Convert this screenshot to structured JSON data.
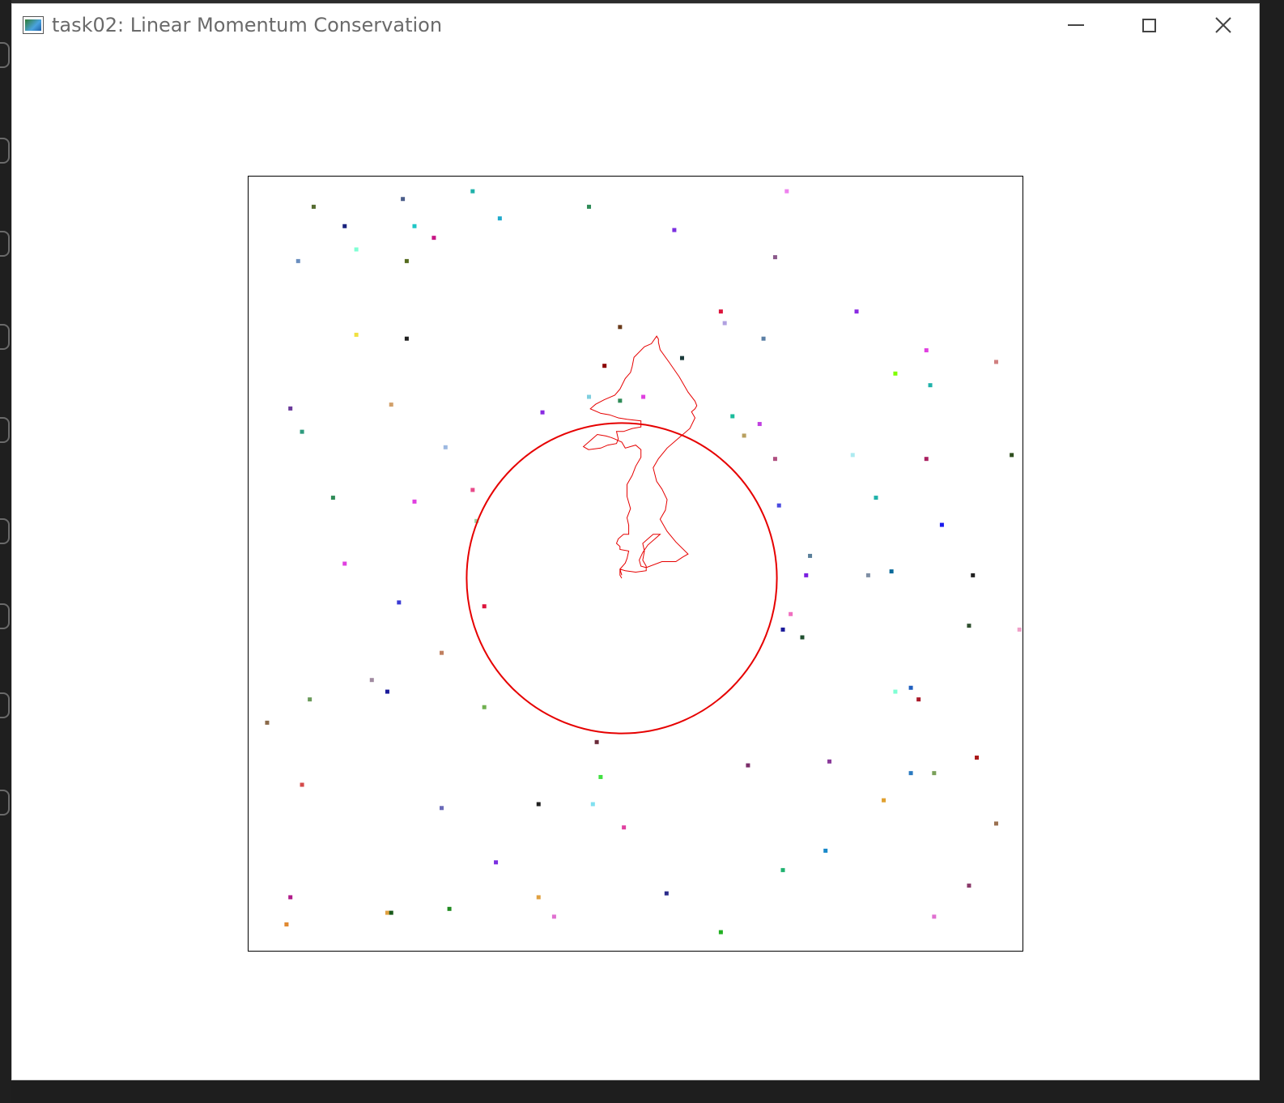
{
  "window": {
    "title": "task02: Linear Momentum Conservation",
    "controls": {
      "minimize": "minimize-icon",
      "maximize": "maximize-icon",
      "close": "close-icon"
    }
  },
  "scene": {
    "frame_color": "#000000",
    "big_particle": {
      "color": "#e60000",
      "radius_units": 0.4,
      "center": [
        0.0,
        0.0
      ]
    },
    "trajectory": {
      "color": "#e60000",
      "points": [
        [
          0.0,
          0.0
        ],
        [
          -0.01,
          0.02
        ],
        [
          -0.01,
          0.06
        ],
        [
          0.02,
          0.05
        ],
        [
          0.08,
          0.04
        ],
        [
          0.14,
          0.05
        ],
        [
          0.14,
          0.08
        ],
        [
          0.12,
          0.12
        ],
        [
          0.13,
          0.18
        ],
        [
          0.12,
          0.23
        ],
        [
          0.15,
          0.26
        ],
        [
          0.18,
          0.29
        ],
        [
          0.22,
          0.29
        ],
        [
          0.19,
          0.26
        ],
        [
          0.15,
          0.22
        ],
        [
          0.12,
          0.17
        ],
        [
          0.1,
          0.12
        ],
        [
          0.11,
          0.08
        ],
        [
          0.14,
          0.07
        ],
        [
          0.23,
          0.11
        ],
        [
          0.31,
          0.11
        ],
        [
          0.35,
          0.14
        ],
        [
          0.38,
          0.16
        ],
        [
          0.38,
          0.16
        ],
        [
          0.31,
          0.24
        ],
        [
          0.26,
          0.31
        ],
        [
          0.22,
          0.39
        ],
        [
          0.25,
          0.45
        ],
        [
          0.26,
          0.52
        ],
        [
          0.23,
          0.59
        ],
        [
          0.2,
          0.64
        ],
        [
          0.18,
          0.73
        ],
        [
          0.21,
          0.79
        ],
        [
          0.26,
          0.86
        ],
        [
          0.33,
          0.93
        ],
        [
          0.39,
          0.99
        ],
        [
          0.42,
          1.06
        ],
        [
          0.4,
          1.1
        ],
        [
          0.42,
          1.12
        ],
        [
          0.43,
          1.14
        ],
        [
          0.42,
          1.17
        ],
        [
          0.38,
          1.23
        ],
        [
          0.33,
          1.33
        ],
        [
          0.27,
          1.43
        ],
        [
          0.22,
          1.51
        ],
        [
          0.21,
          1.56
        ],
        [
          0.21,
          1.58
        ],
        [
          0.2,
          1.6
        ],
        [
          0.17,
          1.55
        ],
        [
          0.13,
          1.53
        ],
        [
          0.07,
          1.46
        ],
        [
          0.06,
          1.4
        ],
        [
          0.05,
          1.36
        ],
        [
          0.02,
          1.32
        ],
        [
          -0.01,
          1.25
        ],
        [
          -0.04,
          1.21
        ],
        [
          -0.1,
          1.18
        ],
        [
          -0.15,
          1.15
        ],
        [
          -0.18,
          1.12
        ],
        [
          -0.12,
          1.09
        ],
        [
          -0.07,
          1.08
        ],
        [
          -0.02,
          1.06
        ],
        [
          0.03,
          1.05
        ],
        [
          0.11,
          1.04
        ],
        [
          0.11,
          1.0
        ],
        [
          0.06,
          0.99
        ],
        [
          0.01,
          0.97
        ],
        [
          -0.03,
          0.97
        ],
        [
          -0.02,
          0.92
        ],
        [
          -0.03,
          0.89
        ],
        [
          -0.08,
          0.88
        ],
        [
          -0.12,
          0.86
        ],
        [
          -0.19,
          0.85
        ],
        [
          -0.22,
          0.87
        ],
        [
          -0.17,
          0.92
        ],
        [
          -0.14,
          0.95
        ],
        [
          -0.09,
          0.94
        ],
        [
          -0.06,
          0.93
        ],
        [
          -0.04,
          0.92
        ],
        [
          0.0,
          0.9
        ],
        [
          0.02,
          0.86
        ],
        [
          0.08,
          0.88
        ],
        [
          0.11,
          0.85
        ],
        [
          0.11,
          0.8
        ],
        [
          0.08,
          0.74
        ],
        [
          0.06,
          0.68
        ],
        [
          0.03,
          0.62
        ],
        [
          0.03,
          0.54
        ],
        [
          0.05,
          0.46
        ],
        [
          0.03,
          0.4
        ],
        [
          0.04,
          0.35
        ],
        [
          0.04,
          0.29
        ],
        [
          0.01,
          0.29
        ],
        [
          -0.02,
          0.26
        ],
        [
          -0.03,
          0.23
        ],
        [
          -0.01,
          0.21
        ],
        [
          -0.01,
          0.19
        ],
        [
          0.04,
          0.18
        ],
        [
          0.03,
          0.13
        ],
        [
          0.02,
          0.1
        ],
        [
          -0.01,
          0.06
        ],
        [
          0.0,
          0.02
        ]
      ]
    },
    "particles": [
      [
        "#556b2f",
        -0.83,
        0.92
      ],
      [
        "#4b5d8a",
        -0.6,
        0.94
      ],
      [
        "#20b2aa",
        -0.42,
        0.96
      ],
      [
        "#2e8b57",
        -0.12,
        0.92
      ],
      [
        "#d4aa00",
        0.27,
        1.02
      ],
      [
        "#ee82ee",
        0.39,
        0.96
      ],
      [
        "#1a237e",
        -0.75,
        0.87
      ],
      [
        "#20c7c7",
        -0.57,
        0.87
      ],
      [
        "#20aacc",
        -0.35,
        0.89
      ],
      [
        "#c71585",
        -0.52,
        0.84
      ],
      [
        "#7b2fe0",
        0.1,
        0.86
      ],
      [
        "#7fffd4",
        -0.72,
        0.81
      ],
      [
        "#6a8ebf",
        -0.87,
        0.78
      ],
      [
        "#556b1f",
        -0.59,
        0.78
      ],
      [
        "#8b5a8b",
        0.36,
        0.79
      ],
      [
        "#8a2be2",
        0.57,
        0.65
      ],
      [
        "#6a3a1a",
        -0.04,
        0.61
      ],
      [
        "#dc143c",
        0.22,
        0.65
      ],
      [
        "#b0a0e0",
        0.23,
        0.62
      ],
      [
        "#5a7fa5",
        0.33,
        0.58
      ],
      [
        "#f0e040",
        -0.72,
        0.59
      ],
      [
        "#202020",
        -0.59,
        0.58
      ],
      [
        "#8b0000",
        -0.08,
        0.51
      ],
      [
        "#1a3a3a",
        0.12,
        0.53
      ],
      [
        "#d08080",
        0.93,
        0.52
      ],
      [
        "#e040e0",
        0.75,
        0.55
      ],
      [
        "#7fff00",
        0.67,
        0.49
      ],
      [
        "#20b2aa",
        0.76,
        0.46
      ],
      [
        "#7fcfdf",
        -0.12,
        0.43
      ],
      [
        "#2e8b57",
        -0.04,
        0.42
      ],
      [
        "#e040e0",
        0.02,
        0.43
      ],
      [
        "#d2a06a",
        -0.63,
        0.41
      ],
      [
        "#6a3a9a",
        -0.89,
        0.4
      ],
      [
        "#8a2be2",
        -0.24,
        0.39
      ],
      [
        "#1abc9c",
        0.25,
        0.38
      ],
      [
        "#c040e0",
        0.32,
        0.36
      ],
      [
        "#b8a060",
        0.28,
        0.33
      ],
      [
        "#2e9b7e",
        -0.86,
        0.34
      ],
      [
        "#9cb8e0",
        -0.49,
        0.3
      ],
      [
        "#adeaf0",
        0.56,
        0.28
      ],
      [
        "#aa2060",
        0.75,
        0.27
      ],
      [
        "#2f4f1f",
        0.97,
        0.28
      ],
      [
        "#b05080",
        0.36,
        0.27
      ],
      [
        "#e84a8a",
        -0.42,
        0.19
      ],
      [
        "#2e8b57",
        -0.78,
        0.17
      ],
      [
        "#e040e0",
        -0.57,
        0.16
      ],
      [
        "#20b2aa",
        0.62,
        0.17
      ],
      [
        "#4a4ae0",
        0.37,
        0.15
      ],
      [
        "#9ad4a0",
        -0.41,
        0.11
      ],
      [
        "#1a1aee",
        0.79,
        0.1
      ],
      [
        "#5a7f9a",
        0.45,
        0.02
      ],
      [
        "#e040e0",
        -0.75,
        0.0
      ],
      [
        "#7b1fe0",
        0.44,
        -0.03
      ],
      [
        "#7f8fa5",
        0.6,
        -0.03
      ],
      [
        "#0a6a9a",
        0.66,
        -0.02
      ],
      [
        "#202020",
        0.87,
        -0.03
      ],
      [
        "#3a3ad4",
        -0.61,
        -0.1
      ],
      [
        "#dc143c",
        -0.39,
        -0.11
      ],
      [
        "#f070c0",
        0.4,
        -0.13
      ],
      [
        "#1a1a9a",
        0.38,
        -0.17
      ],
      [
        "#1f4f2f",
        0.43,
        -0.19
      ],
      [
        "#2f4f2f",
        0.86,
        -0.16
      ],
      [
        "#f0a0c8",
        0.99,
        -0.17
      ],
      [
        "#c08060",
        -0.5,
        -0.23
      ],
      [
        "#a08aa0",
        -0.68,
        -0.3
      ],
      [
        "#1a1a9a",
        -0.64,
        -0.33
      ],
      [
        "#7fffd4",
        0.67,
        -0.33
      ],
      [
        "#2060c0",
        0.71,
        -0.32
      ],
      [
        "#aa1a2a",
        0.73,
        -0.35
      ],
      [
        "#6a9a5a",
        -0.84,
        -0.35
      ],
      [
        "#70b050",
        -0.39,
        -0.37
      ],
      [
        "#8b6a4a",
        -0.95,
        -0.41
      ],
      [
        "#6a2a3a",
        -0.1,
        -0.46
      ],
      [
        "#7b2e6a",
        0.29,
        -0.52
      ],
      [
        "#8a3a9a",
        0.5,
        -0.51
      ],
      [
        "#aa1a1a",
        0.88,
        -0.5
      ],
      [
        "#2a7ac0",
        0.71,
        -0.54
      ],
      [
        "#7aa05a",
        0.77,
        -0.54
      ],
      [
        "#40e040",
        -0.09,
        -0.55
      ],
      [
        "#d44a4a",
        -0.86,
        -0.57
      ],
      [
        "#e0a030",
        0.64,
        -0.61
      ],
      [
        "#6a6ab8",
        -0.5,
        -0.63
      ],
      [
        "#202020",
        -0.25,
        -0.62
      ],
      [
        "#80e0f0",
        -0.11,
        -0.62
      ],
      [
        "#e040a0",
        -0.03,
        -0.68
      ],
      [
        "#9a7050",
        0.93,
        -0.67
      ],
      [
        "#1a8aca",
        0.49,
        -0.74
      ],
      [
        "#7b2fe0",
        -0.36,
        -0.77
      ],
      [
        "#20b270",
        0.38,
        -0.79
      ],
      [
        "#2a2a8a",
        0.08,
        -0.85
      ],
      [
        "#8a3a6a",
        0.86,
        -0.83
      ],
      [
        "#b01a8a",
        -0.89,
        -0.86
      ],
      [
        "#e0a040",
        -0.64,
        -0.9
      ],
      [
        "#e0a040",
        -0.25,
        -0.86
      ],
      [
        "#208a20",
        -0.48,
        -0.89
      ],
      [
        "#1a5a1a",
        -0.63,
        -0.9
      ],
      [
        "#e070d0",
        -0.21,
        -0.91
      ],
      [
        "#e070d0",
        0.77,
        -0.91
      ],
      [
        "#f0b0d0",
        -0.9,
        -0.93
      ],
      [
        "#e08a30",
        -0.9,
        -0.93
      ],
      [
        "#20b020",
        0.22,
        -0.95
      ]
    ]
  }
}
